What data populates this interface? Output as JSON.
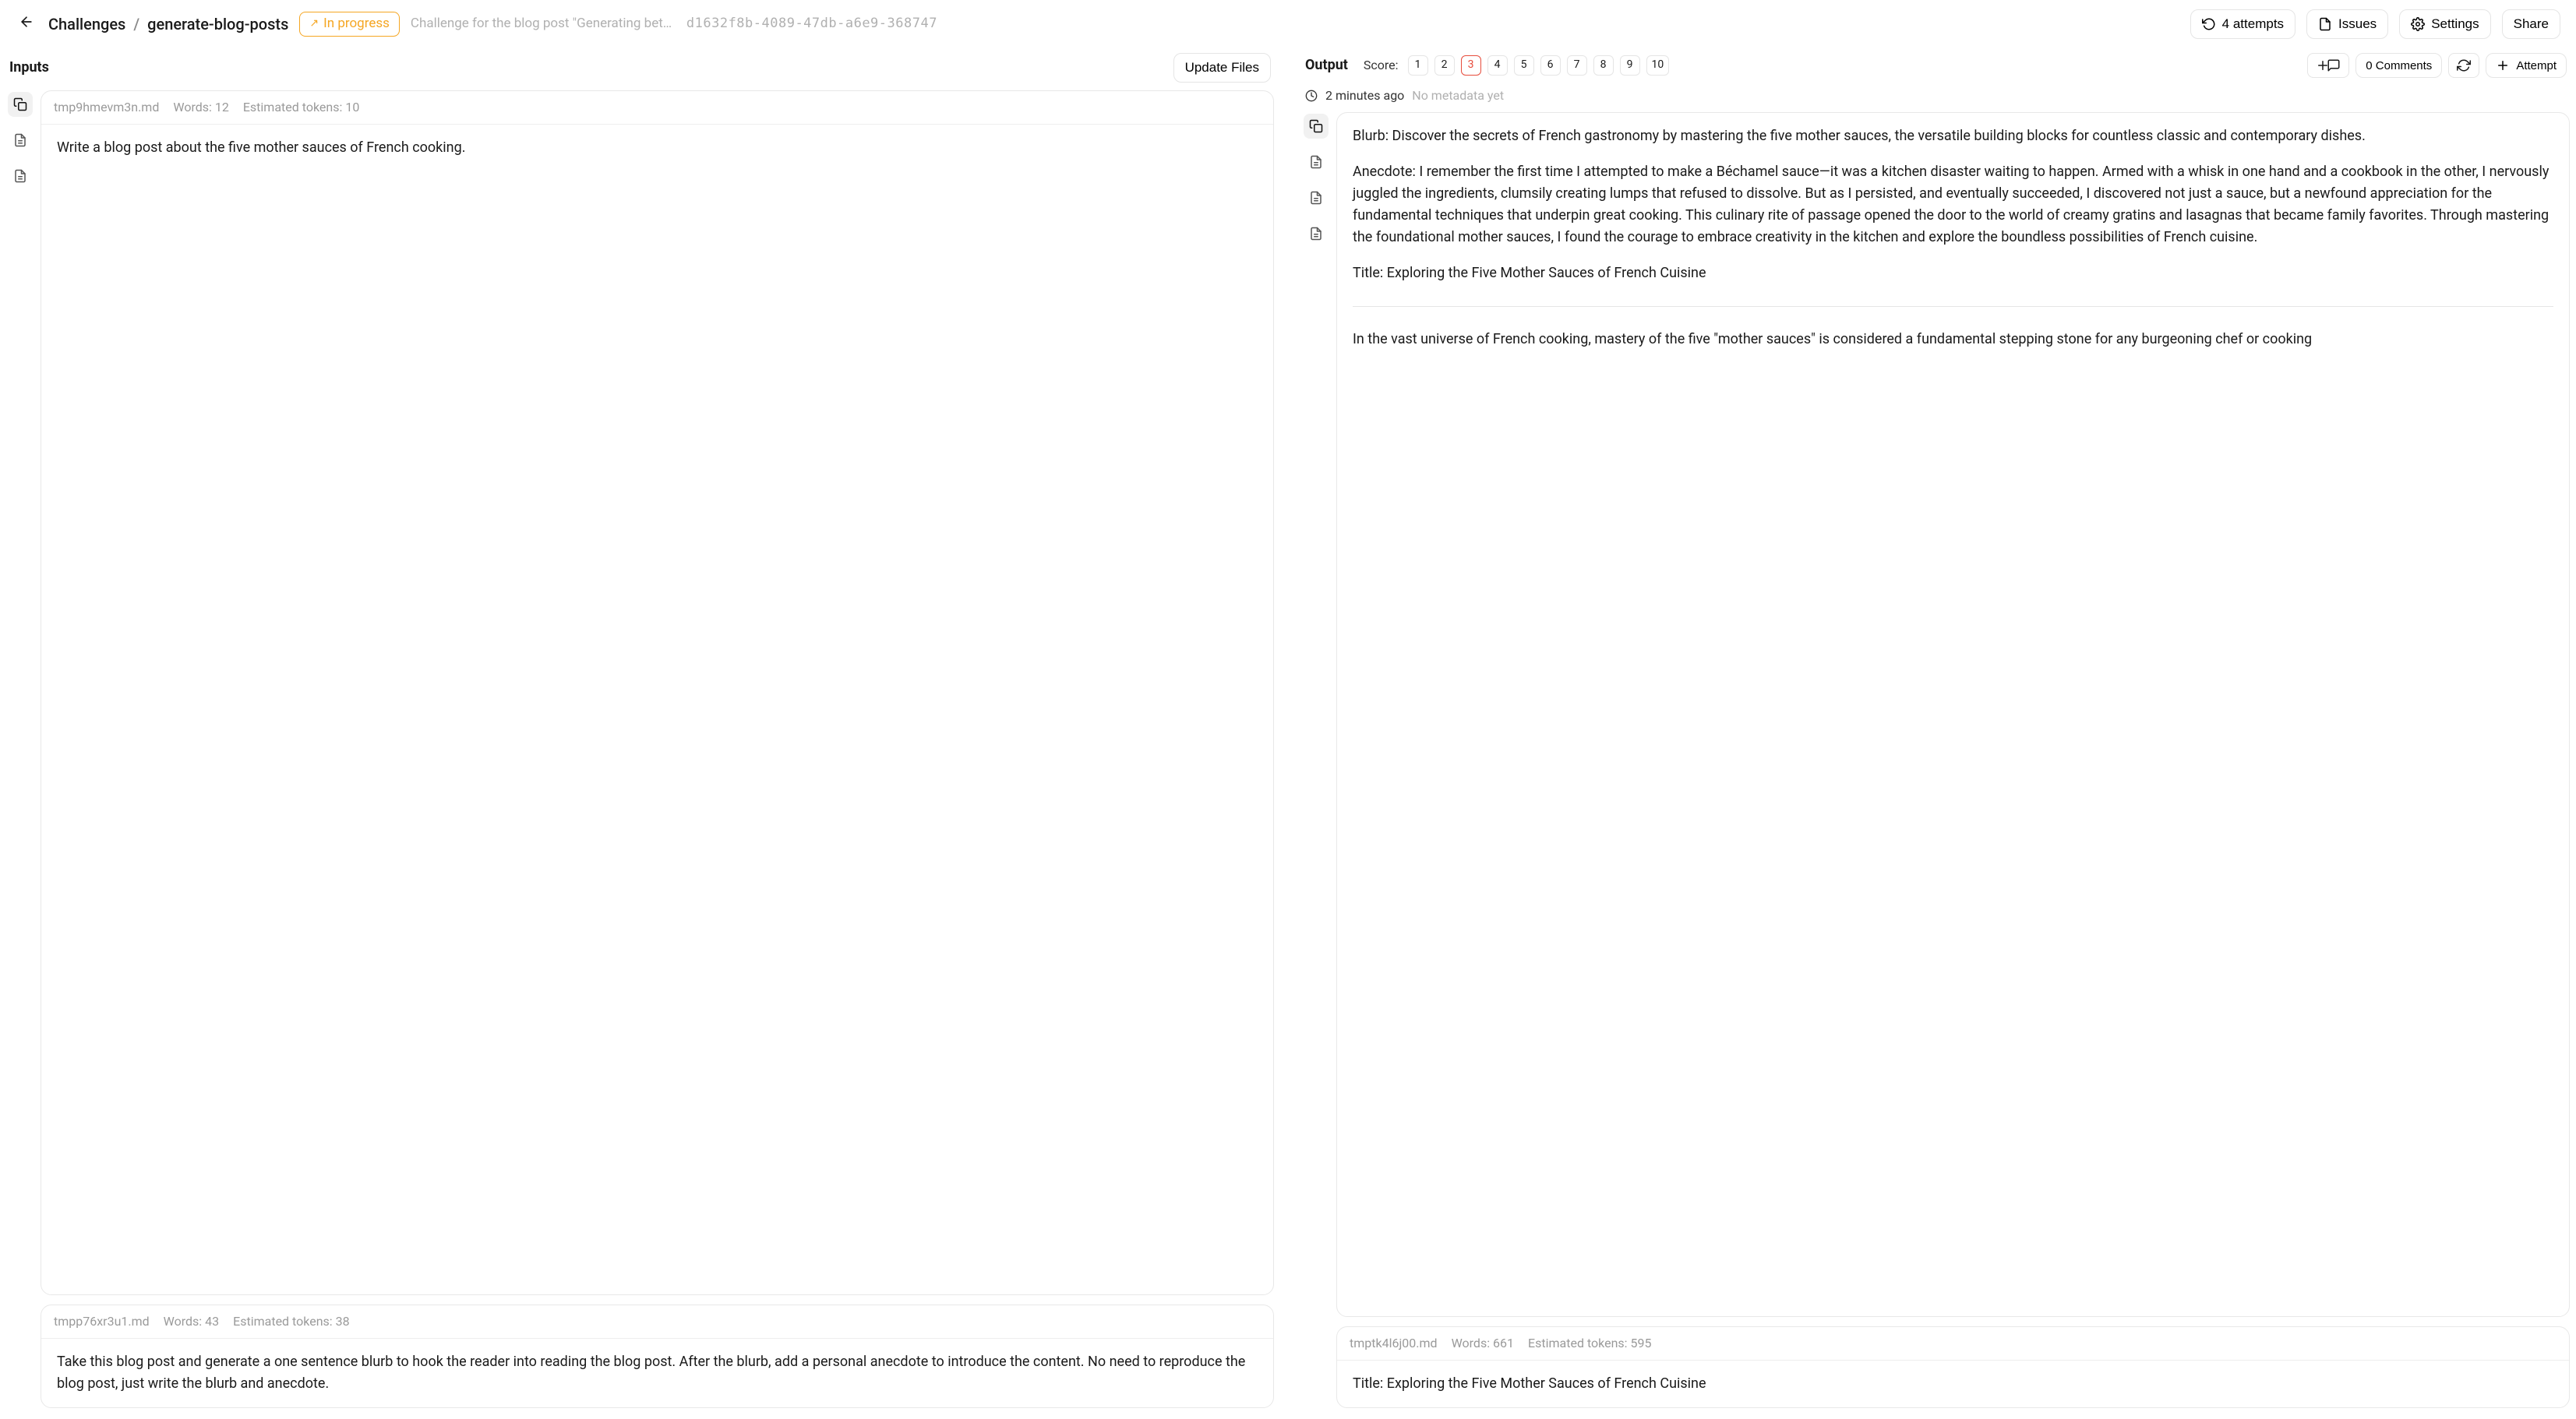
{
  "header": {
    "breadcrumb_root": "Challenges",
    "breadcrumb_leaf": "generate-blog-posts",
    "status_label": "In progress",
    "challenge_desc": "Challenge for the blog post \"Generating better blog...",
    "challenge_id": "d1632f8b-4089-47db-a6e9-368747",
    "attempts_btn": "4 attempts",
    "issues_btn": "Issues",
    "settings_btn": "Settings",
    "share_btn": "Share"
  },
  "inputs": {
    "title": "Inputs",
    "update_btn": "Update Files",
    "cards": [
      {
        "filename": "tmp9hmevm3n.md",
        "words": "Words: 12",
        "tokens": "Estimated tokens: 10",
        "body": "Write a blog post about the five mother sauces of French cooking."
      },
      {
        "filename": "tmpp76xr3u1.md",
        "words": "Words: 43",
        "tokens": "Estimated tokens: 38",
        "body": "Take this blog post and generate a one sentence blurb to hook the reader into reading the blog post. After the blurb, add a personal anecdote to introduce the content. No need to reproduce the blog post, just write the blurb and anecdote."
      }
    ]
  },
  "output": {
    "title": "Output",
    "score_label": "Score:",
    "scores": [
      "1",
      "2",
      "3",
      "4",
      "5",
      "6",
      "7",
      "8",
      "9",
      "10"
    ],
    "selected_score_index": 2,
    "comments_btn": "0 Comments",
    "attempt_btn": "Attempt",
    "timestamp": "2 minutes ago",
    "metadata": "No metadata yet",
    "main_card": {
      "blurb_label": "Blurb: ",
      "blurb_text": "Discover the secrets of French gastronomy by mastering the five mother sauces, the versatile building blocks for countless classic and contemporary dishes.",
      "anecdote_label": "Anecdote: ",
      "anecdote_text": "I remember the first time I attempted to make a Béchamel sauce—it was a kitchen disaster waiting to happen. Armed with a whisk in one hand and a cookbook in the other, I nervously juggled the ingredients, clumsily creating lumps that refused to dissolve. But as I persisted, and eventually succeeded, I discovered not just a sauce, but a newfound appreciation for the fundamental techniques that underpin great cooking. This culinary rite of passage opened the door to the world of creamy gratins and lasagnas that became family favorites. Through mastering the foundational mother sauces, I found the courage to embrace creativity in the kitchen and explore the boundless possibilities of French cuisine.",
      "title_label": "Title: ",
      "title_text": "Exploring the Five Mother Sauces of French Cuisine",
      "intro_para": "In the vast universe of French cooking, mastery of the five \"mother sauces\" is considered a fundamental stepping stone for any burgeoning chef or cooking"
    },
    "secondary_card": {
      "filename": "tmptk4l6j00.md",
      "words": "Words: 661",
      "tokens": "Estimated tokens: 595",
      "title_label": "Title: ",
      "title_text": "Exploring the Five Mother Sauces of French Cuisine"
    }
  }
}
